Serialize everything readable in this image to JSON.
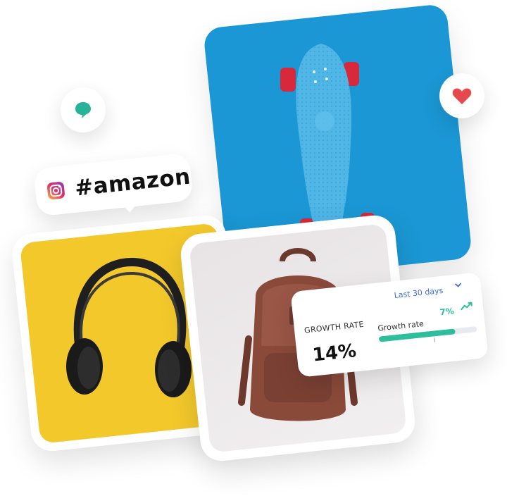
{
  "hashtag": {
    "text": "#amazon",
    "icon": "instagram-icon"
  },
  "badges": {
    "comment": "chat-bubble-icon",
    "like": "heart-icon"
  },
  "growth": {
    "period": "Last 30 days",
    "title": "GROWTH RATE",
    "value": "14%",
    "metric_label": "Growth rate",
    "metric_value": "7%",
    "progress": 0.78
  },
  "colors": {
    "skate_bg": "#1a97d4",
    "yellow_bg": "#f2c82b",
    "accent_green": "#2dbf9c",
    "link_blue": "#3f6fd9",
    "heart_red": "#e5484d",
    "chat_teal": "#26b39a"
  }
}
